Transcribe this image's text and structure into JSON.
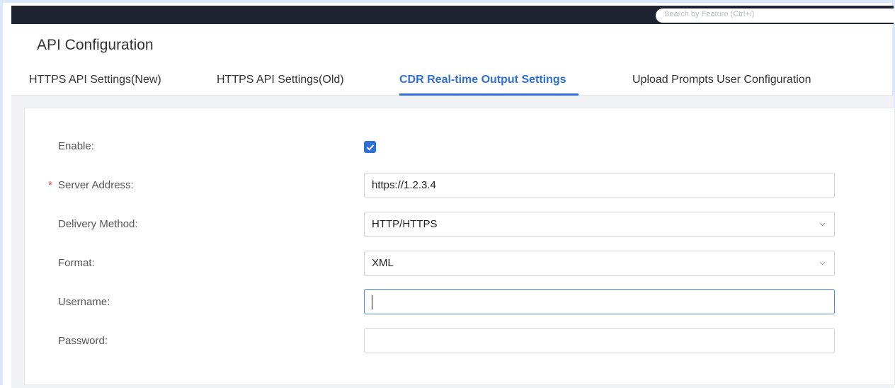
{
  "topbar": {
    "search_text": "Search by Feature (Ctrl+/)"
  },
  "page": {
    "title": "API Configuration"
  },
  "tabs": [
    {
      "label": "HTTPS API Settings(New)",
      "active": false
    },
    {
      "label": "HTTPS API Settings(Old)",
      "active": false
    },
    {
      "label": "CDR Real-time Output Settings",
      "active": true
    },
    {
      "label": "Upload Prompts User Configuration",
      "active": false
    }
  ],
  "form": {
    "enable": {
      "label": "Enable:",
      "checked": true
    },
    "server_address": {
      "label": "Server Address:",
      "required_mark": "*",
      "value": "https://1.2.3.4"
    },
    "delivery_method": {
      "label": "Delivery Method:",
      "value": "HTTP/HTTPS"
    },
    "format": {
      "label": "Format:",
      "value": "XML"
    },
    "username": {
      "label": "Username:",
      "value": ""
    },
    "password": {
      "label": "Password:",
      "value": ""
    }
  },
  "colors": {
    "accent": "#2f6fd6",
    "required": "#e5383b",
    "topbar": "#1f2430"
  },
  "icons": {
    "checkbox": "check-icon",
    "select": "chevron-down-icon"
  }
}
